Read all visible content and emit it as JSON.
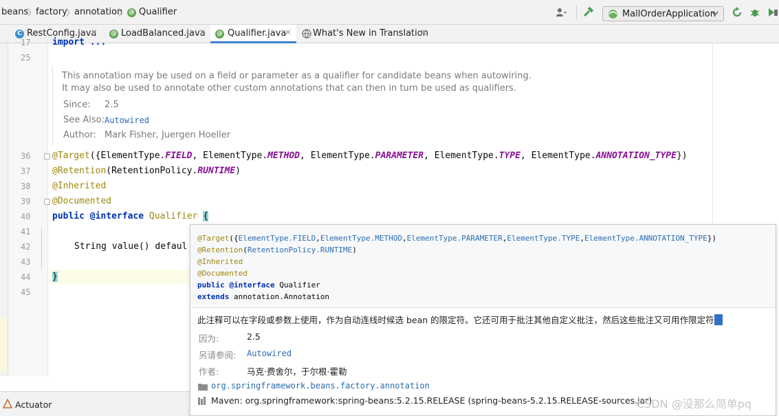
{
  "breadcrumb": {
    "items": [
      "beans",
      "factory",
      "annotation",
      "Qualifier"
    ]
  },
  "toolbar": {
    "run_config": "MallOrderApplication",
    "icons": [
      "user-vcs-icon",
      "build-hammer-icon",
      "run-config-icon",
      "chevron-down-icon",
      "rerun-icon",
      "debug-bug-icon",
      "run-coverage-icon"
    ]
  },
  "tabs": [
    {
      "label": "RestConfig.java",
      "icon": "class-icon",
      "active": false
    },
    {
      "label": "LoadBalanced.java",
      "icon": "annotation-icon",
      "active": false
    },
    {
      "label": "Qualifier.java",
      "icon": "annotation-icon",
      "active": true
    },
    {
      "label": "What's New in Translation",
      "icon": "translation-icon",
      "active": false
    }
  ],
  "editor": {
    "line_numbers": [
      "17",
      "25",
      "36",
      "37",
      "38",
      "39",
      "40",
      "41",
      "42",
      "43",
      "44",
      "45"
    ],
    "top_line": "import ...",
    "doc": {
      "line1": "This annotation may be used on a field or parameter as a qualifier for candidate beans when autowiring.",
      "line2": "It may also be used to annotate other custom annotations that can then in turn be used as qualifiers.",
      "since_label": "Since:",
      "since_value": "2.5",
      "see_also_label": "See Also:",
      "see_also_value": "Autowired",
      "author_label": "Author:",
      "author_value": "Mark Fisher, Juergen Hoeller"
    },
    "code": {
      "target_anno": "@Target",
      "target_open": "({",
      "et": "ElementType.",
      "field": "FIELD",
      "method": "METHOD",
      "parameter": "PARAMETER",
      "type": "TYPE",
      "annotation_type": "ANNOTATION_TYPE",
      "comma": ", ",
      "target_close": "})",
      "retention_anno": "@Retention",
      "retention_open": "(",
      "retention_policy": "RetentionPolicy.",
      "runtime": "RUNTIME",
      "retention_close": ")",
      "inherited": "@Inherited",
      "documented": "@Documented",
      "public_kw": "public",
      "interface_kw": "@interface",
      "class_name": "Qualifier",
      "open_brace": "{",
      "value_decl": "String value() defaul",
      "close_brace": "}"
    }
  },
  "popup": {
    "def_line1": "@Target({ElementType.FIELD,ElementType.METHOD,ElementType.PARAMETER,ElementType.TYPE,ElementType.ANNOTATION_TYPE})",
    "def_target": "@Target",
    "def_open": "({",
    "def_close": "})",
    "def_et_field": "ElementType.FIELD",
    "def_et_method": "ElementType.METHOD",
    "def_et_parameter": "ElementType.PARAMETER",
    "def_et_type": "ElementType.TYPE",
    "def_et_anntype": "ElementType.ANNOTATION_TYPE",
    "def_comma": ",",
    "def_retention": "@Retention",
    "def_retention_open": "(",
    "def_retention_value": "RetentionPolicy.RUNTIME",
    "def_retention_close": ")",
    "def_inherited": "@Inherited",
    "def_documented": "@Documented",
    "def_public": "public",
    "def_interface": "@interface",
    "def_name": "Qualifier",
    "def_extends": "extends",
    "def_super": "annotation.Annotation",
    "description": "此注释可以在字段或参数上使用，作为自动连线时候选 bean 的限定符。它还可用于批注其他自定义批注，然后这些批注又可用作限定符",
    "since_label": "因为:",
    "since_value": "2.5",
    "see_also_label": "另请参阅:",
    "see_also_value": "Autowired",
    "author_label": "作者:",
    "author_value": "马克·费舍尔，于尔根·霍勒",
    "package": "org.springframework.beans.factory.annotation",
    "maven": "Maven: org.springframework:spring-beans:5.2.15.RELEASE (spring-beans-5.2.15.RELEASE-sources.jar)"
  },
  "bottom": {
    "actuator_label": "Actuator"
  },
  "watermark": "CSDN @没那么简单pq"
}
